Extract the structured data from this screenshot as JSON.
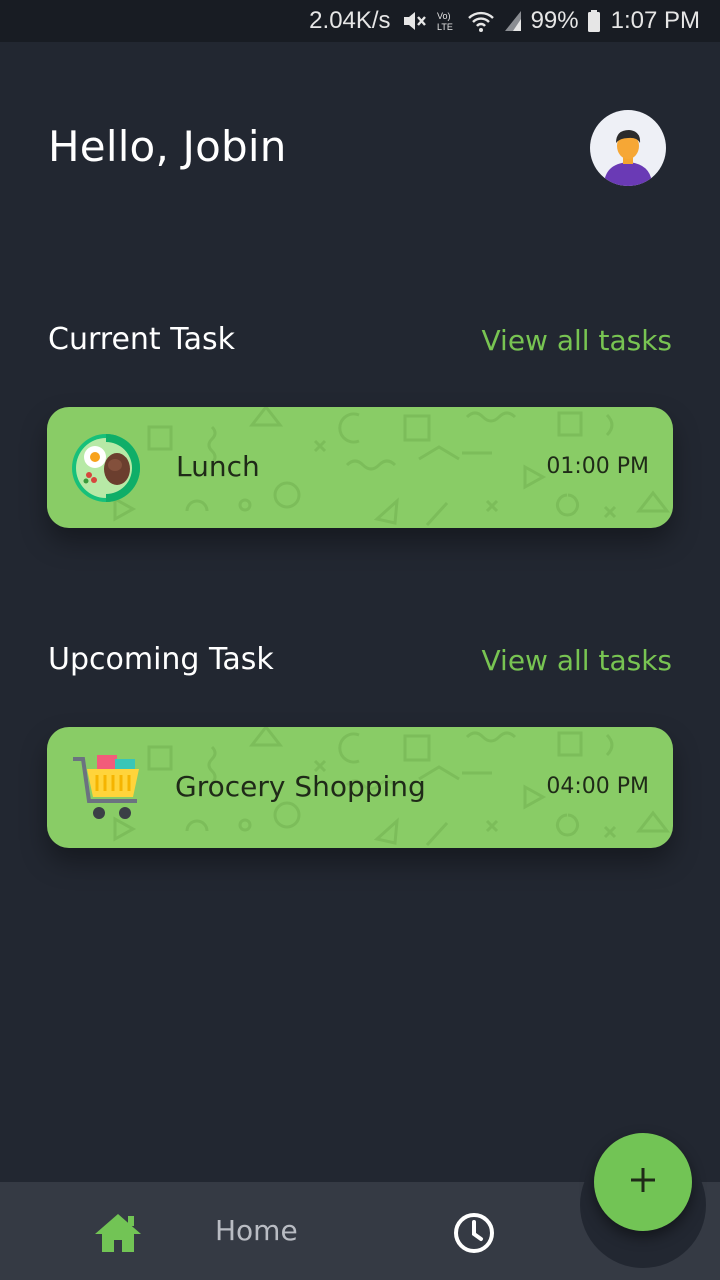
{
  "status_bar": {
    "speed": "2.04K/s",
    "battery": "99%",
    "time": "1:07 PM",
    "icons": [
      "mute-icon",
      "volte-icon",
      "wifi-icon",
      "signal-icon",
      "battery-icon"
    ]
  },
  "header": {
    "greeting": "Hello, Jobin",
    "avatar_icon": "user-avatar-icon"
  },
  "current": {
    "title": "Current Task",
    "view_all": "View all tasks",
    "task": {
      "name": "Lunch",
      "time": "01:00 PM",
      "icon": "lunch-plate-icon"
    }
  },
  "upcoming": {
    "title": "Upcoming Task",
    "view_all": "View all tasks",
    "task": {
      "name": "Grocery Shopping",
      "time": "04:00 PM",
      "icon": "shopping-cart-icon"
    }
  },
  "fab": {
    "label": "+",
    "icon": "plus-icon"
  },
  "nav": {
    "home_label": "Home",
    "home_icon": "home-icon",
    "history_icon": "clock-icon"
  },
  "colors": {
    "background": "#222731",
    "accent": "#78c452",
    "card": "#89cc66",
    "nav": "#353a44"
  }
}
